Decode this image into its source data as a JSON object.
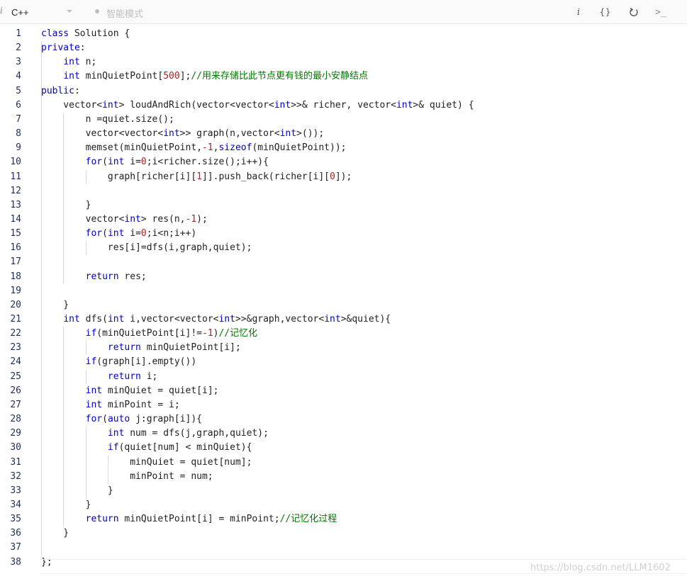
{
  "toolbar": {
    "language": "C++",
    "mode_label": "智能模式",
    "info_glyph": "i",
    "format_glyph": "{}",
    "console_glyph": ">_"
  },
  "icons": {
    "info": "info-icon",
    "format": "braces-icon",
    "reset": "reset-icon",
    "console": "console-icon",
    "dropdown": "chevron-down-icon"
  },
  "colors": {
    "keyword": "#0000cc",
    "number": "#aa2222",
    "comment": "#007a00",
    "text": "#1f1f1f",
    "line_number": "#1f2d5a"
  },
  "code": {
    "lines": [
      [
        [
          "k",
          "class"
        ],
        [
          "t",
          " Solution {"
        ]
      ],
      [
        [
          "k",
          "private"
        ],
        [
          "t",
          ":"
        ]
      ],
      [
        [
          "t",
          "    "
        ],
        [
          "k",
          "int"
        ],
        [
          "t",
          " n;"
        ]
      ],
      [
        [
          "t",
          "    "
        ],
        [
          "k",
          "int"
        ],
        [
          "t",
          " minQuietPoint["
        ],
        [
          "n",
          "500"
        ],
        [
          "t",
          "];"
        ],
        [
          "c",
          "//用来存储比此节点更有钱的最小安静结点"
        ]
      ],
      [
        [
          "k",
          "public"
        ],
        [
          "t",
          ":"
        ]
      ],
      [
        [
          "t",
          "    vector<"
        ],
        [
          "k",
          "int"
        ],
        [
          "t",
          "> loudAndRich(vector<vector<"
        ],
        [
          "k",
          "int"
        ],
        [
          "t",
          ">>& richer, vector<"
        ],
        [
          "k",
          "int"
        ],
        [
          "t",
          ">& quiet) {"
        ]
      ],
      [
        [
          "t",
          "        n =quiet.size();"
        ]
      ],
      [
        [
          "t",
          "        vector<vector<"
        ],
        [
          "k",
          "int"
        ],
        [
          "t",
          ">> graph(n,vector<"
        ],
        [
          "k",
          "int"
        ],
        [
          "t",
          ">());"
        ]
      ],
      [
        [
          "t",
          "        memset(minQuietPoint,"
        ],
        [
          "n",
          "-1"
        ],
        [
          "t",
          ","
        ],
        [
          "k",
          "sizeof"
        ],
        [
          "t",
          "(minQuietPoint));"
        ]
      ],
      [
        [
          "t",
          "        "
        ],
        [
          "k",
          "for"
        ],
        [
          "t",
          "("
        ],
        [
          "k",
          "int"
        ],
        [
          "t",
          " i="
        ],
        [
          "n",
          "0"
        ],
        [
          "t",
          ";i<richer.size();i++){"
        ]
      ],
      [
        [
          "t",
          "            graph[richer[i]["
        ],
        [
          "n",
          "1"
        ],
        [
          "t",
          "]].push_back(richer[i]["
        ],
        [
          "n",
          "0"
        ],
        [
          "t",
          "]);"
        ]
      ],
      [
        [
          "t",
          ""
        ]
      ],
      [
        [
          "t",
          "        }"
        ]
      ],
      [
        [
          "t",
          "        vector<"
        ],
        [
          "k",
          "int"
        ],
        [
          "t",
          "> res(n,"
        ],
        [
          "n",
          "-1"
        ],
        [
          "t",
          ");"
        ]
      ],
      [
        [
          "t",
          "        "
        ],
        [
          "k",
          "for"
        ],
        [
          "t",
          "("
        ],
        [
          "k",
          "int"
        ],
        [
          "t",
          " i="
        ],
        [
          "n",
          "0"
        ],
        [
          "t",
          ";i<n;i++)"
        ]
      ],
      [
        [
          "t",
          "            res[i]=dfs(i,graph,quiet);"
        ]
      ],
      [
        [
          "t",
          ""
        ]
      ],
      [
        [
          "t",
          "        "
        ],
        [
          "k",
          "return"
        ],
        [
          "t",
          " res;"
        ]
      ],
      [
        [
          "t",
          ""
        ]
      ],
      [
        [
          "t",
          "    }"
        ]
      ],
      [
        [
          "t",
          "    "
        ],
        [
          "k",
          "int"
        ],
        [
          "t",
          " dfs("
        ],
        [
          "k",
          "int"
        ],
        [
          "t",
          " i,vector<vector<"
        ],
        [
          "k",
          "int"
        ],
        [
          "t",
          ">>&graph,vector<"
        ],
        [
          "k",
          "int"
        ],
        [
          "t",
          ">&quiet){"
        ]
      ],
      [
        [
          "t",
          "        "
        ],
        [
          "k",
          "if"
        ],
        [
          "t",
          "(minQuietPoint[i]!="
        ],
        [
          "n",
          "-1"
        ],
        [
          "t",
          ")"
        ],
        [
          "c",
          "//记忆化"
        ]
      ],
      [
        [
          "t",
          "            "
        ],
        [
          "k",
          "return"
        ],
        [
          "t",
          " minQuietPoint[i];"
        ]
      ],
      [
        [
          "t",
          "        "
        ],
        [
          "k",
          "if"
        ],
        [
          "t",
          "(graph[i].empty())"
        ]
      ],
      [
        [
          "t",
          "            "
        ],
        [
          "k",
          "return"
        ],
        [
          "t",
          " i;"
        ]
      ],
      [
        [
          "t",
          "        "
        ],
        [
          "k",
          "int"
        ],
        [
          "t",
          " minQuiet = quiet[i];"
        ]
      ],
      [
        [
          "t",
          "        "
        ],
        [
          "k",
          "int"
        ],
        [
          "t",
          " minPoint = i;"
        ]
      ],
      [
        [
          "t",
          "        "
        ],
        [
          "k",
          "for"
        ],
        [
          "t",
          "("
        ],
        [
          "k",
          "auto"
        ],
        [
          "t",
          " j:graph[i]){"
        ]
      ],
      [
        [
          "t",
          "            "
        ],
        [
          "k",
          "int"
        ],
        [
          "t",
          " num = dfs(j,graph,quiet);"
        ]
      ],
      [
        [
          "t",
          "            "
        ],
        [
          "k",
          "if"
        ],
        [
          "t",
          "(quiet[num] < minQuiet){"
        ]
      ],
      [
        [
          "t",
          "                minQuiet = quiet[num];"
        ]
      ],
      [
        [
          "t",
          "                minPoint = num;"
        ]
      ],
      [
        [
          "t",
          "            }"
        ]
      ],
      [
        [
          "t",
          "        }"
        ]
      ],
      [
        [
          "t",
          "        "
        ],
        [
          "k",
          "return"
        ],
        [
          "t",
          " minQuietPoint[i] = minPoint;"
        ],
        [
          "c",
          "//记忆化过程"
        ]
      ],
      [
        [
          "t",
          "    }"
        ]
      ],
      [
        [
          "t",
          ""
        ]
      ],
      [
        [
          "t",
          "};"
        ]
      ]
    ]
  },
  "watermark": "https://blog.csdn.net/LLM1602"
}
